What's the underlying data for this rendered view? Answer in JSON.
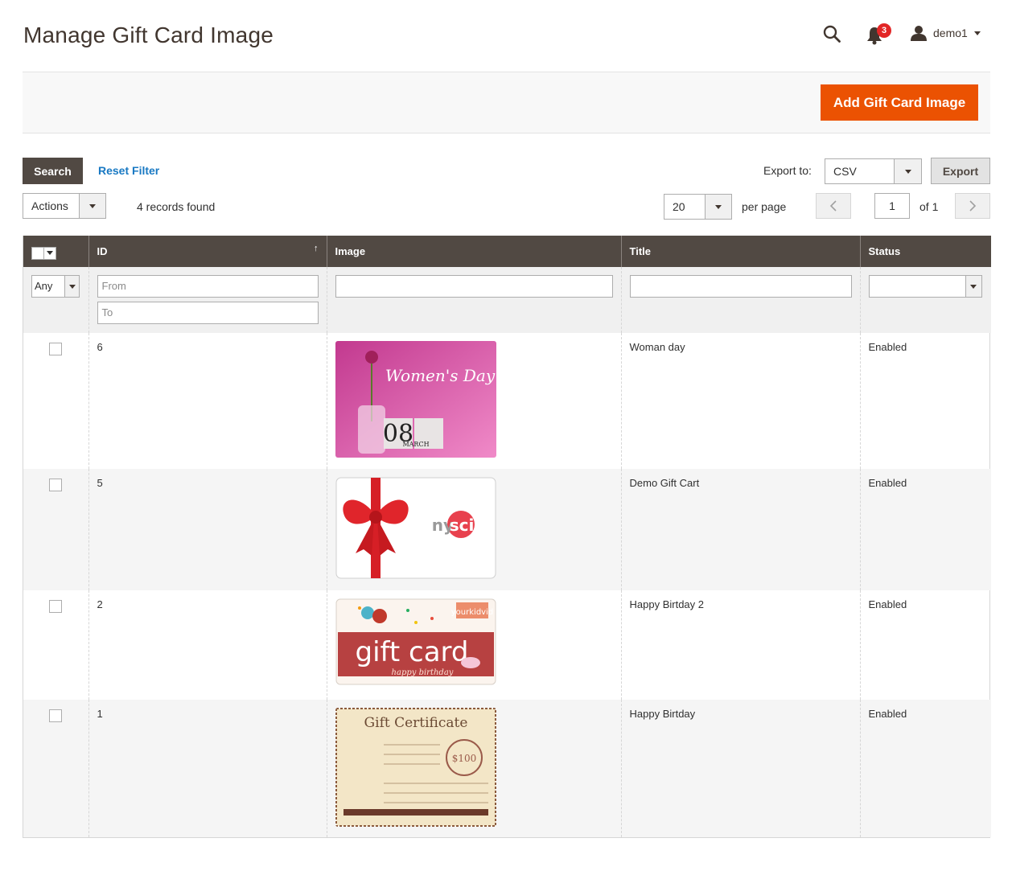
{
  "header": {
    "title": "Manage Gift Card Image",
    "notifications_count": "3",
    "user_name": "demo1"
  },
  "action_bar": {
    "add_label": "Add Gift Card Image"
  },
  "toolbar": {
    "search_label": "Search",
    "reset_label": "Reset Filter",
    "export_label": "Export to:",
    "export_format": "CSV",
    "export_button": "Export",
    "actions_label": "Actions",
    "records_found": "4 records found",
    "per_page_value": "20",
    "per_page_label": "per page",
    "current_page": "1",
    "page_of": "of 1"
  },
  "grid": {
    "columns": {
      "id": "ID",
      "image": "Image",
      "title": "Title",
      "status": "Status"
    },
    "filters": {
      "any": "Any",
      "from_placeholder": "From",
      "to_placeholder": "To"
    },
    "rows": [
      {
        "id": "6",
        "title": "Woman day",
        "status": "Enabled",
        "image_text": "Women's Day",
        "image_sub": "MARCH",
        "image_num": "08"
      },
      {
        "id": "5",
        "title": "Demo Gift Cart",
        "status": "Enabled",
        "image_text": "nysci"
      },
      {
        "id": "2",
        "title": "Happy Birtday 2",
        "status": "Enabled",
        "image_text": "gift card",
        "image_sub": "happy birthday",
        "image_brand": "yourkidvid"
      },
      {
        "id": "1",
        "title": "Happy Birtday",
        "status": "Enabled",
        "image_text": "Gift Certificate",
        "image_sub": "$100"
      }
    ]
  },
  "colors": {
    "accent": "#eb5202",
    "header_bg": "#514943",
    "link": "#1979c3"
  }
}
